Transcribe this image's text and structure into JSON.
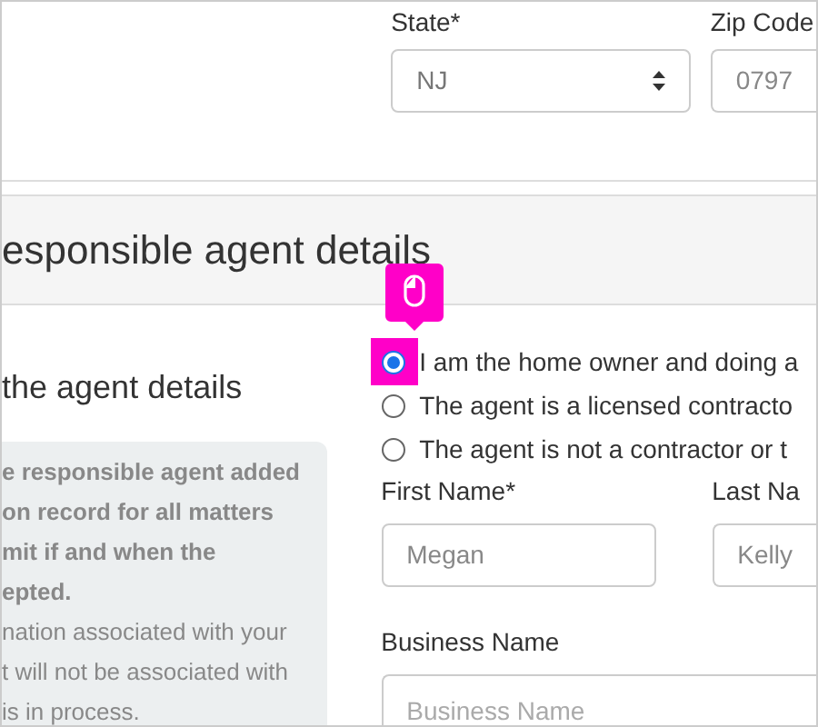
{
  "address": {
    "state": {
      "label": "State*",
      "value": "NJ"
    },
    "zip": {
      "label": "Zip Code",
      "value": "0797"
    }
  },
  "section": {
    "title": "esponsible agent details"
  },
  "left": {
    "heading": "the agent details",
    "note_bold": [
      "e responsible agent added",
      "on record for all matters",
      "mit if and when the",
      "epted."
    ],
    "note": [
      "nation associated with your",
      "t will not be associated with",
      "is in process."
    ]
  },
  "options": [
    {
      "label": "I am the home owner and doing a",
      "selected": true
    },
    {
      "label": "The agent is a licensed contracto",
      "selected": false
    },
    {
      "label": "The agent is not a contractor or t",
      "selected": false
    }
  ],
  "first_name": {
    "label": "First Name*",
    "value": "Megan"
  },
  "last_name": {
    "label": "Last Na",
    "value": "Kelly"
  },
  "business_name": {
    "label": "Business Name",
    "placeholder": "Business Name"
  }
}
